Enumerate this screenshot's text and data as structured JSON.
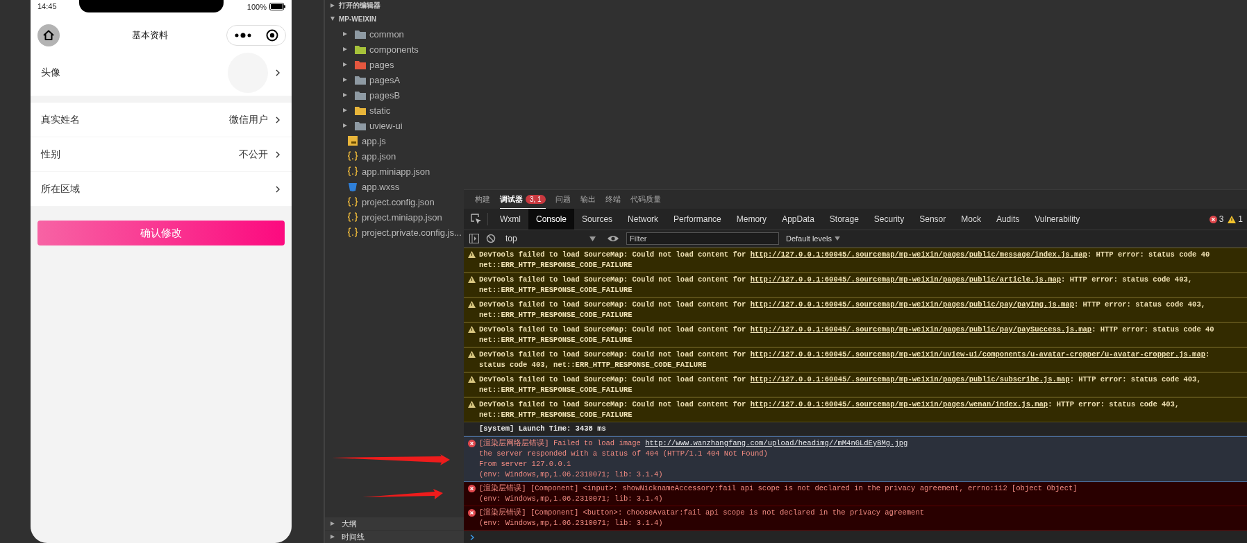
{
  "phone": {
    "status": {
      "time": "14:45",
      "battery": "100%"
    },
    "nav": {
      "title": "基本资料"
    },
    "rows": [
      {
        "kind": "avatar",
        "label": "头像"
      },
      {
        "kind": "text",
        "label": "真实姓名",
        "value": "微信用户"
      },
      {
        "kind": "text",
        "label": "性别",
        "value": "不公开"
      },
      {
        "kind": "text",
        "label": "所在区域"
      }
    ],
    "button": "确认修改"
  },
  "sidebar": {
    "open_editors": {
      "label": "打开的编辑器",
      "expanded": false
    },
    "project": {
      "label": "MP-WEIXIN",
      "expanded": true,
      "items": [
        {
          "kind": "folder",
          "label": "common",
          "color": "#8e9aa3",
          "expanded": false
        },
        {
          "kind": "folder",
          "label": "components",
          "color": "#a6c23a",
          "expanded": false
        },
        {
          "kind": "folder",
          "label": "pages",
          "color": "#e5573f",
          "expanded": false
        },
        {
          "kind": "folder",
          "label": "pagesA",
          "color": "#8e9aa3",
          "expanded": false
        },
        {
          "kind": "folder",
          "label": "pagesB",
          "color": "#8e9aa3",
          "expanded": false
        },
        {
          "kind": "folder",
          "label": "static",
          "color": "#e8b53a",
          "expanded": false
        },
        {
          "kind": "folder",
          "label": "uview-ui",
          "color": "#8e9aa3",
          "expanded": false
        },
        {
          "kind": "js",
          "label": "app.js"
        },
        {
          "kind": "json",
          "label": "app.json"
        },
        {
          "kind": "json",
          "label": "app.miniapp.json"
        },
        {
          "kind": "css",
          "label": "app.wxss"
        },
        {
          "kind": "json",
          "label": "project.config.json"
        },
        {
          "kind": "json",
          "label": "project.miniapp.json"
        },
        {
          "kind": "json",
          "label": "project.private.config.js..."
        }
      ]
    },
    "bottom": [
      {
        "label": "大纲",
        "expanded": false
      },
      {
        "label": "时间线",
        "expanded": false
      }
    ]
  },
  "devtools": {
    "top_tabs": [
      {
        "label": "构建",
        "selected": false
      },
      {
        "label": "调试器",
        "selected": true,
        "badge": "3, 1"
      },
      {
        "label": "问题",
        "selected": false
      },
      {
        "label": "输出",
        "selected": false
      },
      {
        "label": "终端",
        "selected": false
      },
      {
        "label": "代码质量",
        "selected": false
      }
    ],
    "panel_tabs": [
      {
        "label": "Wxml",
        "selected": false
      },
      {
        "label": "Console",
        "selected": true
      },
      {
        "label": "Sources",
        "selected": false
      },
      {
        "label": "Network",
        "selected": false
      },
      {
        "label": "Performance",
        "selected": false
      },
      {
        "label": "Memory",
        "selected": false
      },
      {
        "label": "AppData",
        "selected": false
      },
      {
        "label": "Storage",
        "selected": false
      },
      {
        "label": "Security",
        "selected": false
      },
      {
        "label": "Sensor",
        "selected": false
      },
      {
        "label": "Mock",
        "selected": false
      },
      {
        "label": "Audits",
        "selected": false
      },
      {
        "label": "Vulnerability",
        "selected": false
      }
    ],
    "error_count": "3",
    "warning_count": "1",
    "toolbar": {
      "context": "top",
      "filter_placeholder": "Filter",
      "levels": "Default levels"
    },
    "messages": [
      {
        "kind": "warning",
        "text": "DevTools failed to load SourceMap: Could not load content for ",
        "link": "http://127.0.0.1:60045/.sourcemap/mp-weixin/pages/public/message/index.js.map",
        "after": ": HTTP error: status code 40",
        "more": [
          "net::ERR_HTTP_RESPONSE_CODE_FAILURE"
        ]
      },
      {
        "kind": "warning",
        "text": "DevTools failed to load SourceMap: Could not load content for ",
        "link": "http://127.0.0.1:60045/.sourcemap/mp-weixin/pages/public/article.js.map",
        "after": ": HTTP error: status code 403,",
        "more": [
          "net::ERR_HTTP_RESPONSE_CODE_FAILURE"
        ]
      },
      {
        "kind": "warning",
        "text": "DevTools failed to load SourceMap: Could not load content for ",
        "link": "http://127.0.0.1:60045/.sourcemap/mp-weixin/pages/public/pay/payIng.js.map",
        "after": ": HTTP error: status code 403,",
        "more": [
          "net::ERR_HTTP_RESPONSE_CODE_FAILURE"
        ]
      },
      {
        "kind": "warning",
        "text": "DevTools failed to load SourceMap: Could not load content for ",
        "link": "http://127.0.0.1:60045/.sourcemap/mp-weixin/pages/public/pay/paySuccess.js.map",
        "after": ": HTTP error: status code 40",
        "more": [
          "net::ERR_HTTP_RESPONSE_CODE_FAILURE"
        ]
      },
      {
        "kind": "warning",
        "text": "DevTools failed to load SourceMap: Could not load content for ",
        "link": "http://127.0.0.1:60045/.sourcemap/mp-weixin/uview-ui/components/u-avatar-cropper/u-avatar-cropper.js.map",
        "after": ":",
        "more": [
          "status code 403, net::ERR_HTTP_RESPONSE_CODE_FAILURE"
        ]
      },
      {
        "kind": "warning",
        "text": "DevTools failed to load SourceMap: Could not load content for ",
        "link": "http://127.0.0.1:60045/.sourcemap/mp-weixin/pages/public/subscribe.js.map",
        "after": ": HTTP error: status code 403,",
        "more": [
          "net::ERR_HTTP_RESPONSE_CODE_FAILURE"
        ]
      },
      {
        "kind": "warning",
        "text": "DevTools failed to load SourceMap: Could not load content for ",
        "link": "http://127.0.0.1:60045/.sourcemap/mp-weixin/pages/wenan/index.js.map",
        "after": ": HTTP error: status code 403,",
        "more": [
          "net::ERR_HTTP_RESPONSE_CODE_FAILURE"
        ]
      },
      {
        "kind": "system",
        "text": "[system] Launch Time: 3438 ms"
      },
      {
        "kind": "network-error",
        "text": "[渲染层网络层错误] Failed to load image ",
        "link": "http://www.wanzhangfang.com/upload/headimg//mM4nGLdEyBMg.jpg",
        "more": [
          "the server responded with a status of 404 (HTTP/1.1 404 Not Found)",
          "From server 127.0.0.1",
          "(env: Windows,mp,1.06.2310071; lib: 3.1.4)"
        ]
      },
      {
        "kind": "error",
        "text": "[渲染层错误] [Component] <input>: showNicknameAccessory:fail api scope is not declared in the privacy agreement, errno:112 [object Object]",
        "more": [
          "(env: Windows,mp,1.06.2310071; lib: 3.1.4)"
        ]
      },
      {
        "kind": "error",
        "text": "[渲染层错误] [Component] <button>: chooseAvatar:fail api scope is not declared in the privacy agreement",
        "more": [
          "(env: Windows,mp,1.06.2310071; lib: 3.1.4)"
        ]
      }
    ]
  }
}
